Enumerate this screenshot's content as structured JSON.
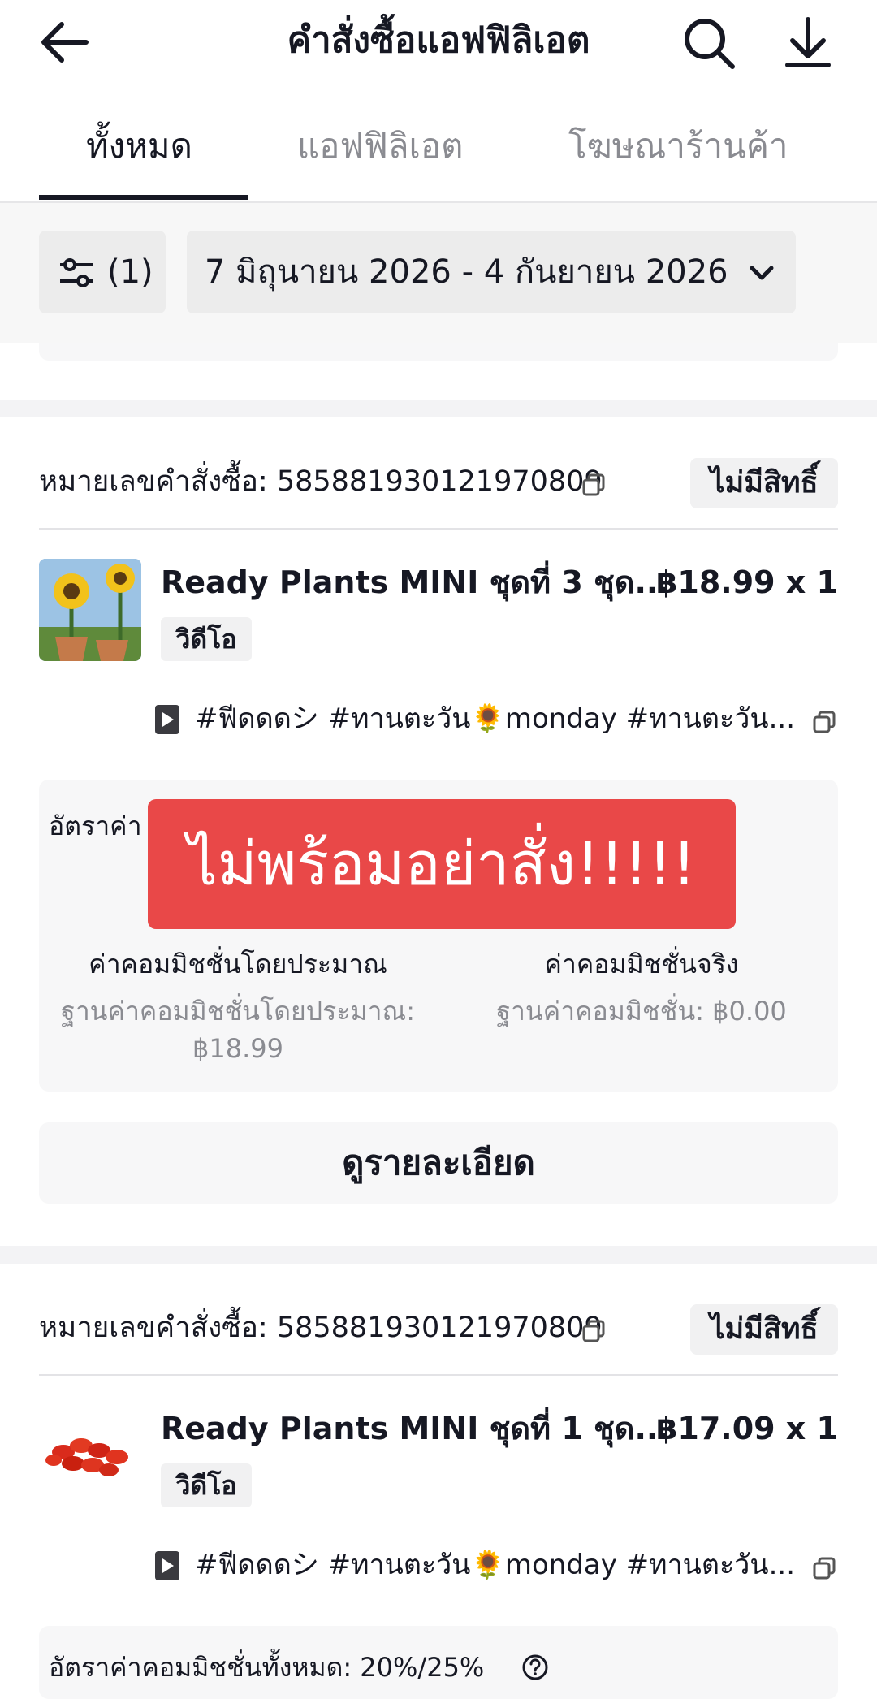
{
  "header": {
    "title": "คำสั่งซื้อแอฟฟิลิเอต",
    "icons": [
      "back-arrow-icon",
      "search-icon",
      "download-icon"
    ]
  },
  "tabs": [
    {
      "label": "ทั้งหมด",
      "active": true
    },
    {
      "label": "แอฟฟิลิเอต",
      "active": false
    },
    {
      "label": "โฆษณาร้านค้า",
      "active": false
    }
  ],
  "filter": {
    "count_label": "(1)",
    "date_range": "7 มิถุนายน 2026 - 4 กันยายน 2026"
  },
  "orders": [
    {
      "order_label": "หมายเลขคำสั่งซื้อ: 585881930121970809",
      "status_badge": "ไม่มีสิทธิ์",
      "product_name": "Ready Plants MINI ชุดที่ 3 ชุด...",
      "price_qty": "฿18.99 x 1",
      "tag": "วิดีโอ",
      "video_caption": "#ฟีดดดシ #ทานตะวัน🌻monday #ทานตะวัน...",
      "commission_rate_label": "อัตราค่า",
      "est_title": "ค่าคอมมิชชั่นโดยประมาณ",
      "est_base": "ฐานค่าคอมมิชชั่นโดยประมาณ: ฿18.99",
      "actual_title": "ค่าคอมมิชชั่นจริง",
      "actual_base": "ฐานค่าคอมมิชชั่น: ฿0.00",
      "details_button": "ดูรายละเอียด"
    },
    {
      "order_label": "หมายเลขคำสั่งซื้อ: 585881930121970809",
      "status_badge": "ไม่มีสิทธิ์",
      "product_name": "Ready Plants MINI ชุดที่ 1 ชุด...",
      "price_qty": "฿17.09 x 1",
      "tag": "วิดีโอ",
      "video_caption": "#ฟีดดดシ #ทานตะวัน🌻monday #ทานตะวัน...",
      "commission_rate_label": "อัตราค่าคอมมิชชั่นทั้งหมด: 20%/25%"
    }
  ],
  "overlay": {
    "text": "ไม่พร้อมอย่าสั่ง!!!!!",
    "color": "#e94848"
  }
}
